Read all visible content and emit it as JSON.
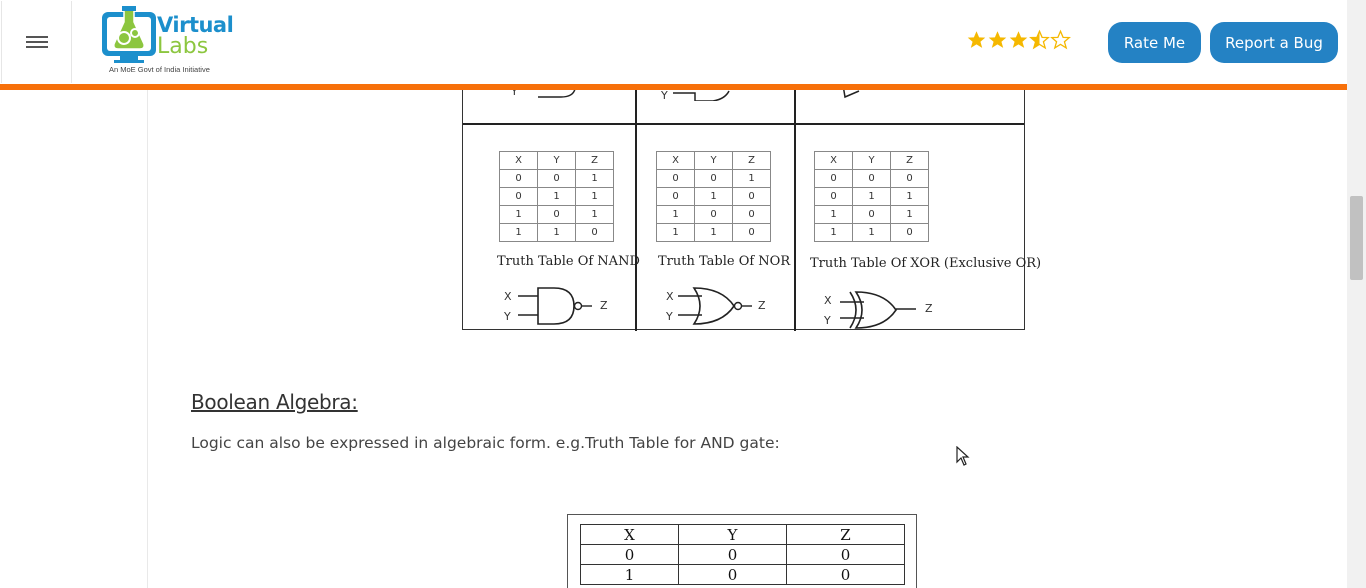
{
  "header": {
    "menu_icon": "hamburger-icon",
    "logo": {
      "line1": "Virtual",
      "line2": "Labs",
      "tagline": "An MoE Govt of India Initiative"
    },
    "rating": {
      "value": 3.5,
      "max": 5,
      "star_color": "#f5b800"
    },
    "rate_button": "Rate Me",
    "bug_button": "Report a Bug",
    "accent_bar_color": "#f7700a",
    "button_color": "#2482c4"
  },
  "gates_figure": {
    "tables": [
      {
        "gate": "NAND",
        "caption": "Truth Table Of NAND",
        "headers": [
          "X",
          "Y",
          "Z"
        ],
        "rows": [
          [
            "0",
            "0",
            "1"
          ],
          [
            "0",
            "1",
            "1"
          ],
          [
            "1",
            "0",
            "1"
          ],
          [
            "1",
            "1",
            "0"
          ]
        ],
        "inputs": [
          "X",
          "Y"
        ],
        "output": "Z"
      },
      {
        "gate": "NOR",
        "caption": "Truth Table Of NOR",
        "headers": [
          "X",
          "Y",
          "Z"
        ],
        "rows": [
          [
            "0",
            "0",
            "1"
          ],
          [
            "0",
            "1",
            "0"
          ],
          [
            "1",
            "0",
            "0"
          ],
          [
            "1",
            "1",
            "0"
          ]
        ],
        "inputs": [
          "X",
          "Y"
        ],
        "output": "Z"
      },
      {
        "gate": "XOR",
        "caption": "Truth Table Of  XOR (Exclusive OR)",
        "headers": [
          "X",
          "Y",
          "Z"
        ],
        "rows": [
          [
            "0",
            "0",
            "0"
          ],
          [
            "0",
            "1",
            "1"
          ],
          [
            "1",
            "0",
            "1"
          ],
          [
            "1",
            "1",
            "0"
          ]
        ],
        "inputs": [
          "X",
          "Y"
        ],
        "output": "Z"
      }
    ],
    "top_row_labels": [
      "Y",
      "Y"
    ]
  },
  "section": {
    "title": "Boolean Algebra:",
    "paragraph": "Logic can also be expressed in algebraic form. e.g.Truth Table for AND gate:"
  },
  "and_table": {
    "headers": [
      "X",
      "Y",
      "Z"
    ],
    "rows": [
      [
        "0",
        "0",
        "0"
      ],
      [
        "1",
        "0",
        "0"
      ]
    ]
  }
}
